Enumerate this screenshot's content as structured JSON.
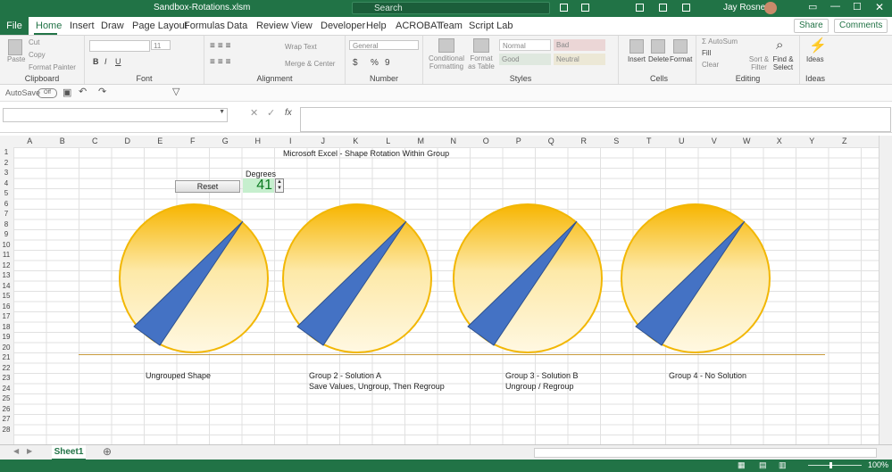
{
  "titlebar": {
    "filename": "Sandbox-Rotations.xlsm",
    "search_placeholder": "Search",
    "user": "Jay Rosner"
  },
  "tabs": [
    "File",
    "Home",
    "Insert",
    "Draw",
    "Page Layout",
    "Formulas",
    "Data",
    "Review",
    "View",
    "Developer",
    "Help",
    "ACROBAT",
    "Team",
    "Script Lab"
  ],
  "header_buttons": {
    "share": "Share",
    "comments": "Comments"
  },
  "ribbon": {
    "clipboard": {
      "label": "Clipboard",
      "paste": "Paste",
      "cut": "Cut",
      "copy": "Copy",
      "format_painter": "Format Painter"
    },
    "font": {
      "label": "Font",
      "size": "11"
    },
    "alignment": {
      "label": "Alignment",
      "wrap": "Wrap Text",
      "merge": "Merge & Center"
    },
    "number": {
      "label": "Number",
      "format": "General"
    },
    "styles": {
      "label": "Styles",
      "conditional": "Conditional Formatting",
      "format_table": "Format as Table",
      "normal": "Normal",
      "bad": "Bad",
      "good": "Good",
      "neutral": "Neutral"
    },
    "cells": {
      "label": "Cells",
      "insert": "Insert",
      "delete": "Delete",
      "format": "Format"
    },
    "editing": {
      "label": "Editing",
      "autosum": "AutoSum",
      "fill": "Fill",
      "clear": "Clear",
      "sort": "Sort & Filter",
      "find": "Find & Select"
    },
    "ideas": {
      "label": "Ideas",
      "ideas": "Ideas"
    }
  },
  "qat": {
    "autosave": "AutoSave",
    "autosave_state": "Off"
  },
  "formula_bar": {
    "fx": "fx"
  },
  "columns": [
    "A",
    "B",
    "C",
    "D",
    "E",
    "F",
    "G",
    "H",
    "I",
    "J",
    "K",
    "L",
    "M",
    "N",
    "O",
    "P",
    "Q",
    "R",
    "S",
    "T",
    "U",
    "V",
    "W",
    "X",
    "Y",
    "Z"
  ],
  "sheet": {
    "title": "Microsoft Excel - Shape Rotation Within Group",
    "degrees_label": "Degrees",
    "degrees_value": "41",
    "reset": "Reset",
    "captions": [
      {
        "line1": "Ungrouped Shape",
        "line2": ""
      },
      {
        "line1": "Group 2 - Solution A",
        "line2": "Save Values, Ungroup, Then Regroup"
      },
      {
        "line1": "Group 3 - Solution B",
        "line2": "Ungroup / Regroup"
      },
      {
        "line1": "Group 4 - No Solution",
        "line2": ""
      }
    ]
  },
  "sheet_tabs": {
    "active": "Sheet1"
  },
  "status": {
    "zoom": "100%"
  },
  "colors": {
    "accent": "#217346",
    "pointer": "#4472c4",
    "dial_edge": "#f2b705",
    "good_fill": "#c6efce"
  }
}
